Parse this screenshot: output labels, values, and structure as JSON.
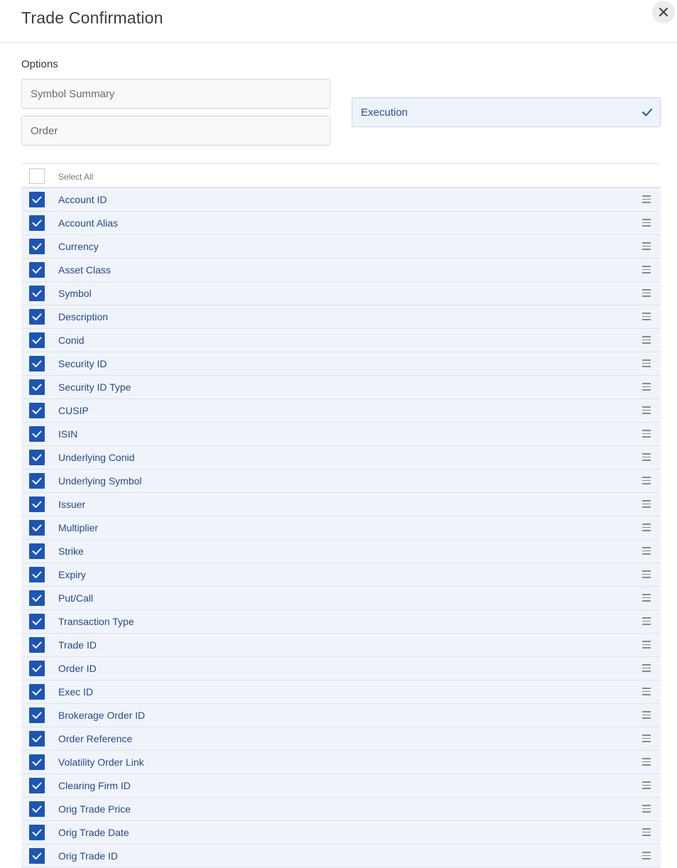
{
  "dialog": {
    "title": "Trade Confirmation",
    "close_icon": "close-icon"
  },
  "options": {
    "label": "Options",
    "symbol_summary": "Symbol Summary",
    "order": "Order",
    "execution": "Execution",
    "selected": "Execution"
  },
  "columns": {
    "select_all_label": "Select All",
    "select_all_checked": false,
    "items": [
      {
        "label": "Account ID",
        "checked": true
      },
      {
        "label": "Account Alias",
        "checked": true
      },
      {
        "label": "Currency",
        "checked": true
      },
      {
        "label": "Asset Class",
        "checked": true
      },
      {
        "label": "Symbol",
        "checked": true
      },
      {
        "label": "Description",
        "checked": true
      },
      {
        "label": "Conid",
        "checked": true
      },
      {
        "label": "Security ID",
        "checked": true
      },
      {
        "label": "Security ID Type",
        "checked": true
      },
      {
        "label": "CUSIP",
        "checked": true
      },
      {
        "label": "ISIN",
        "checked": true
      },
      {
        "label": "Underlying Conid",
        "checked": true
      },
      {
        "label": "Underlying Symbol",
        "checked": true
      },
      {
        "label": "Issuer",
        "checked": true
      },
      {
        "label": "Multiplier",
        "checked": true
      },
      {
        "label": "Strike",
        "checked": true
      },
      {
        "label": "Expiry",
        "checked": true
      },
      {
        "label": "Put/Call",
        "checked": true
      },
      {
        "label": "Transaction Type",
        "checked": true
      },
      {
        "label": "Trade ID",
        "checked": true
      },
      {
        "label": "Order ID",
        "checked": true
      },
      {
        "label": "Exec ID",
        "checked": true
      },
      {
        "label": "Brokerage Order ID",
        "checked": true
      },
      {
        "label": "Order Reference",
        "checked": true
      },
      {
        "label": "Volatility Order Link",
        "checked": true
      },
      {
        "label": "Clearing Firm ID",
        "checked": true
      },
      {
        "label": "Orig Trade Price",
        "checked": true
      },
      {
        "label": "Orig Trade Date",
        "checked": true
      },
      {
        "label": "Orig Trade ID",
        "checked": true
      }
    ]
  },
  "colors": {
    "accent": "#1c55b8",
    "row_background": "#f0f4fa",
    "label_text": "#1f4a8f"
  }
}
